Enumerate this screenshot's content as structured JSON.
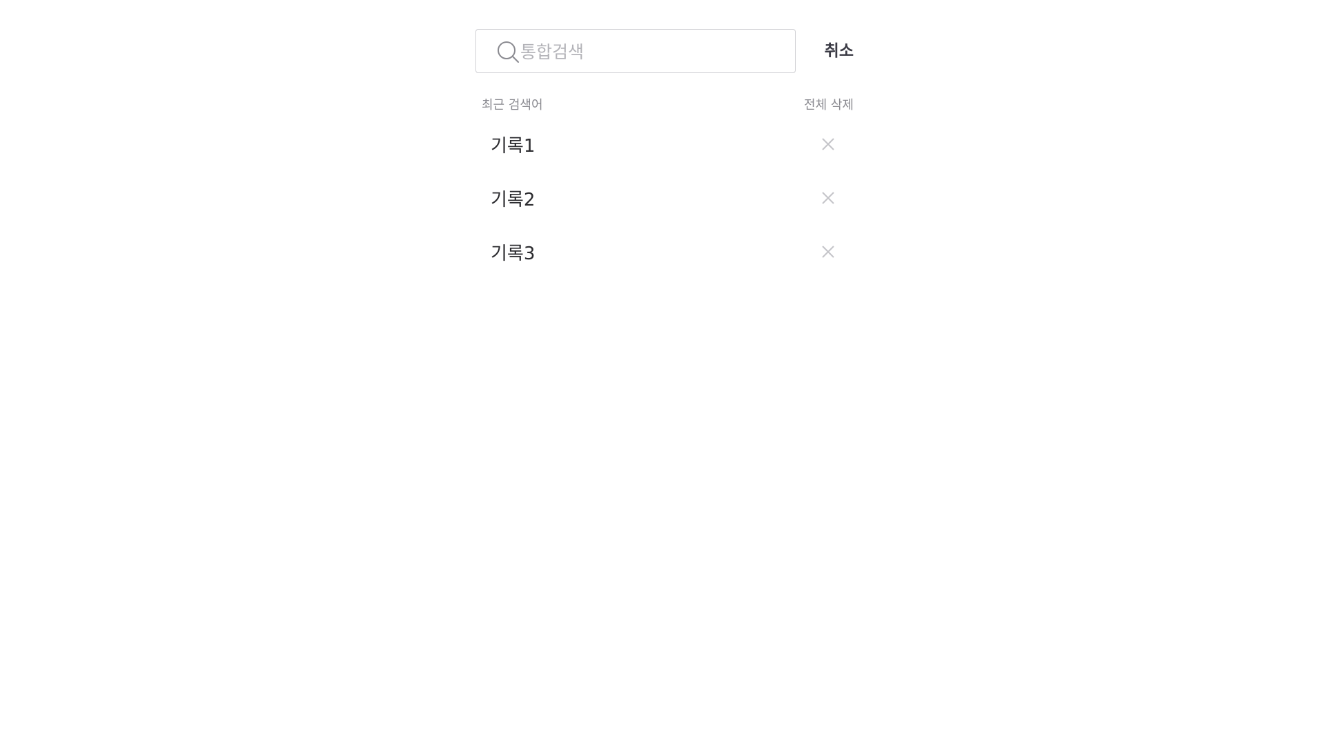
{
  "search": {
    "placeholder": "통합검색",
    "value": "",
    "icon": "search-icon",
    "cancel_label": "취소"
  },
  "recent": {
    "title": "최근 검색어",
    "clear_all_label": "전체 삭제",
    "items": [
      {
        "label": "기록1",
        "remove_icon": "close-icon"
      },
      {
        "label": "기록2",
        "remove_icon": "close-icon"
      },
      {
        "label": "기록3",
        "remove_icon": "close-icon"
      }
    ]
  },
  "colors": {
    "border": "#cfcfd3",
    "placeholder": "#b3b3b8",
    "muted_text": "#8a8a90",
    "item_text": "#2b2b2f",
    "close_icon": "#c4c4c8"
  }
}
